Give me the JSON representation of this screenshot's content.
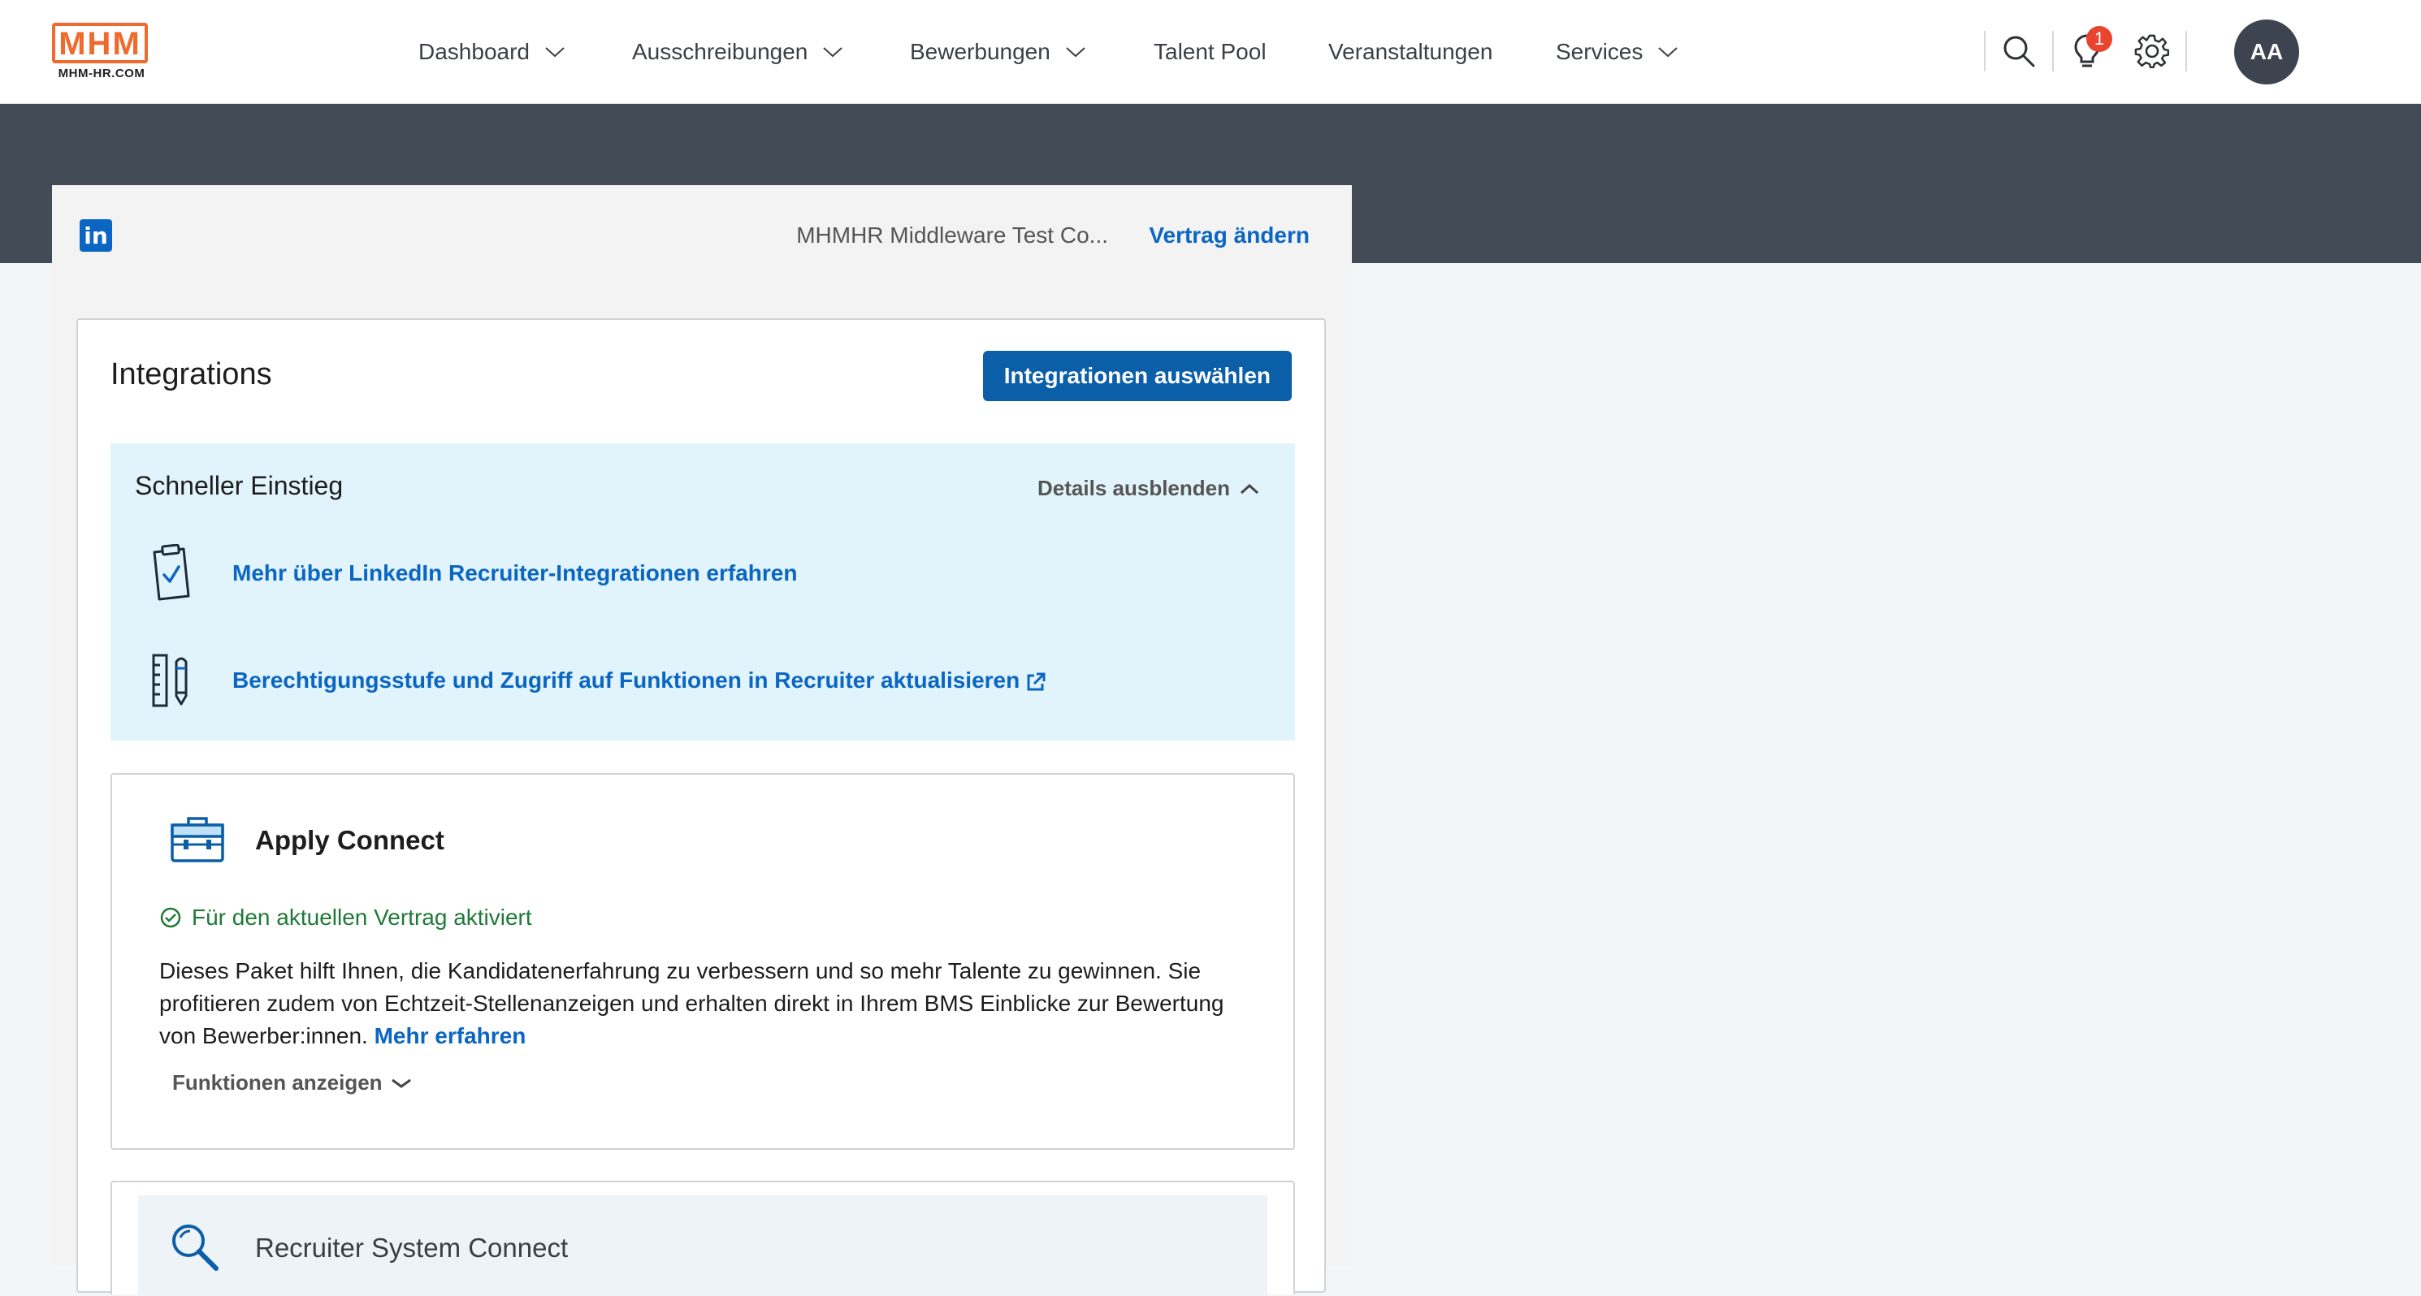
{
  "brand": {
    "logo_text": "MHM",
    "logo_sub": "MHM-HR.COM",
    "accent": "#ef6a2c"
  },
  "nav": {
    "items": [
      {
        "label": "Dashboard",
        "dropdown": true
      },
      {
        "label": "Ausschreibungen",
        "dropdown": true
      },
      {
        "label": "Bewerbungen",
        "dropdown": true
      },
      {
        "label": "Talent Pool",
        "dropdown": false
      },
      {
        "label": "Veranstaltungen",
        "dropdown": false
      },
      {
        "label": "Services",
        "dropdown": true
      }
    ],
    "notification_count": "1",
    "avatar_initials": "AA"
  },
  "panel": {
    "provider_icon": "linkedin-icon",
    "contract_name": "MHMHR Middleware Test Co...",
    "change_contract": "Vertrag ändern"
  },
  "integrations": {
    "title": "Integrations",
    "select_button": "Integrationen auswählen",
    "quick_start": {
      "title": "Schneller Einstieg",
      "toggle_label": "Details ausblenden",
      "links": [
        {
          "icon": "clipboard-check-icon",
          "label": "Mehr über LinkedIn Recruiter-Integrationen erfahren"
        },
        {
          "icon": "ruler-pencil-icon",
          "label": "Berechtigungsstufe und Zugriff auf Funktionen in Recruiter aktualisieren",
          "external": true
        }
      ]
    },
    "packages": [
      {
        "icon": "briefcase-icon",
        "title": "Apply Connect",
        "status": "Für den aktuellen Vertrag aktiviert",
        "description": "Dieses Paket hilft Ihnen, die Kandidatenerfahrung zu verbessern und so mehr Talente zu gewinnen. Sie profitieren zudem von Echtzeit-Stellenanzeigen und erhalten direkt in Ihrem BMS Einblicke zur Bewertung von Bewerber:innen.",
        "learn_more": "Mehr erfahren",
        "show_features": "Funktionen anzeigen"
      },
      {
        "icon": "magnifier-icon",
        "title": "Recruiter System Connect"
      }
    ]
  },
  "colors": {
    "primary": "#0b5ea8",
    "link": "#0a66c2",
    "success": "#1f7a37",
    "band": "#434b56",
    "quick_bg": "#e1f3fb"
  }
}
